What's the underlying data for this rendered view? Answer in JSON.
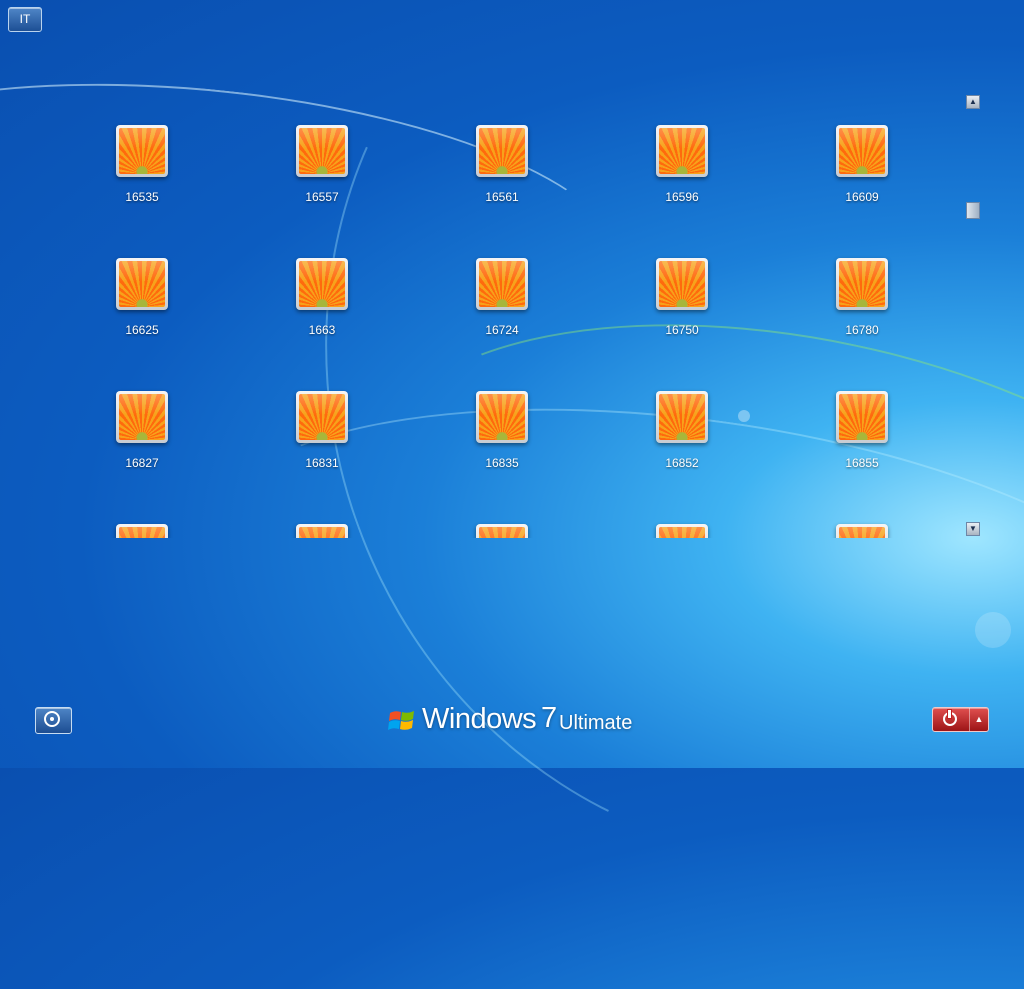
{
  "language_button": {
    "label": "IT"
  },
  "users": [
    {
      "name": "16535"
    },
    {
      "name": "16557"
    },
    {
      "name": "16561"
    },
    {
      "name": "16596"
    },
    {
      "name": "16609"
    },
    {
      "name": "16625"
    },
    {
      "name": "1663"
    },
    {
      "name": "16724"
    },
    {
      "name": "16750"
    },
    {
      "name": "16780"
    },
    {
      "name": "16827"
    },
    {
      "name": "16831"
    },
    {
      "name": "16835"
    },
    {
      "name": "16852"
    },
    {
      "name": "16855"
    },
    {
      "name": ""
    },
    {
      "name": ""
    },
    {
      "name": ""
    },
    {
      "name": ""
    },
    {
      "name": ""
    }
  ],
  "scrollbar": {
    "up_icon": "scroll-up-arrow",
    "down_icon": "scroll-down-arrow"
  },
  "ease_of_access": {
    "icon": "ease-of-access-icon"
  },
  "branding": {
    "word": "Windows",
    "version": "7",
    "edition": "Ultimate"
  },
  "power": {
    "icon": "power-icon",
    "options_icon": "chevron-up-icon"
  },
  "colors": {
    "background": "#0c5cc0",
    "power_red": "#b01a1c"
  }
}
